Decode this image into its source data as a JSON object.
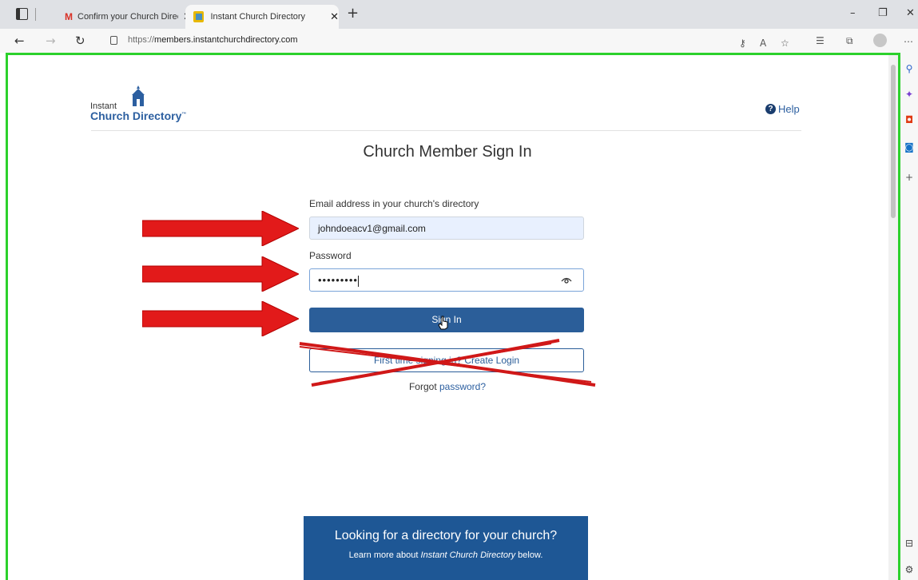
{
  "browser": {
    "tabs": [
      {
        "title": "Confirm your Church Directory E",
        "icon": "gmail-icon",
        "active": false
      },
      {
        "title": "Instant Church Directory",
        "icon": "icd-favicon",
        "active": true
      }
    ],
    "new_tab": "+",
    "url_scheme": "https://",
    "url_host": "members.instantchurchdirectory.com",
    "window_controls": {
      "minimize": "–",
      "restore": "❐",
      "close": "✕"
    }
  },
  "page": {
    "logo": {
      "line1": "Instant",
      "line2": "Church Directory",
      "tm": "™"
    },
    "help_label": "Help",
    "title": "Church Member Sign In",
    "email": {
      "label": "Email address in your church's directory",
      "value": "johndoeacv1@gmail.com"
    },
    "password": {
      "label": "Password",
      "masked_value": "•••••••••"
    },
    "sign_in_button": "Sign In",
    "first_time_button": "First time signing in? Create Login",
    "forgot_prefix": "Forgot ",
    "forgot_link": "password?",
    "promo": {
      "title": "Looking for a directory for your church?",
      "sub_prefix": "Learn more about ",
      "sub_em": "Instant Church Directory",
      "sub_suffix": " below."
    }
  },
  "colors": {
    "primary": "#2b5e99",
    "annotation_arrow": "#e21a1a",
    "viewport_highlight": "#2cd12c"
  }
}
